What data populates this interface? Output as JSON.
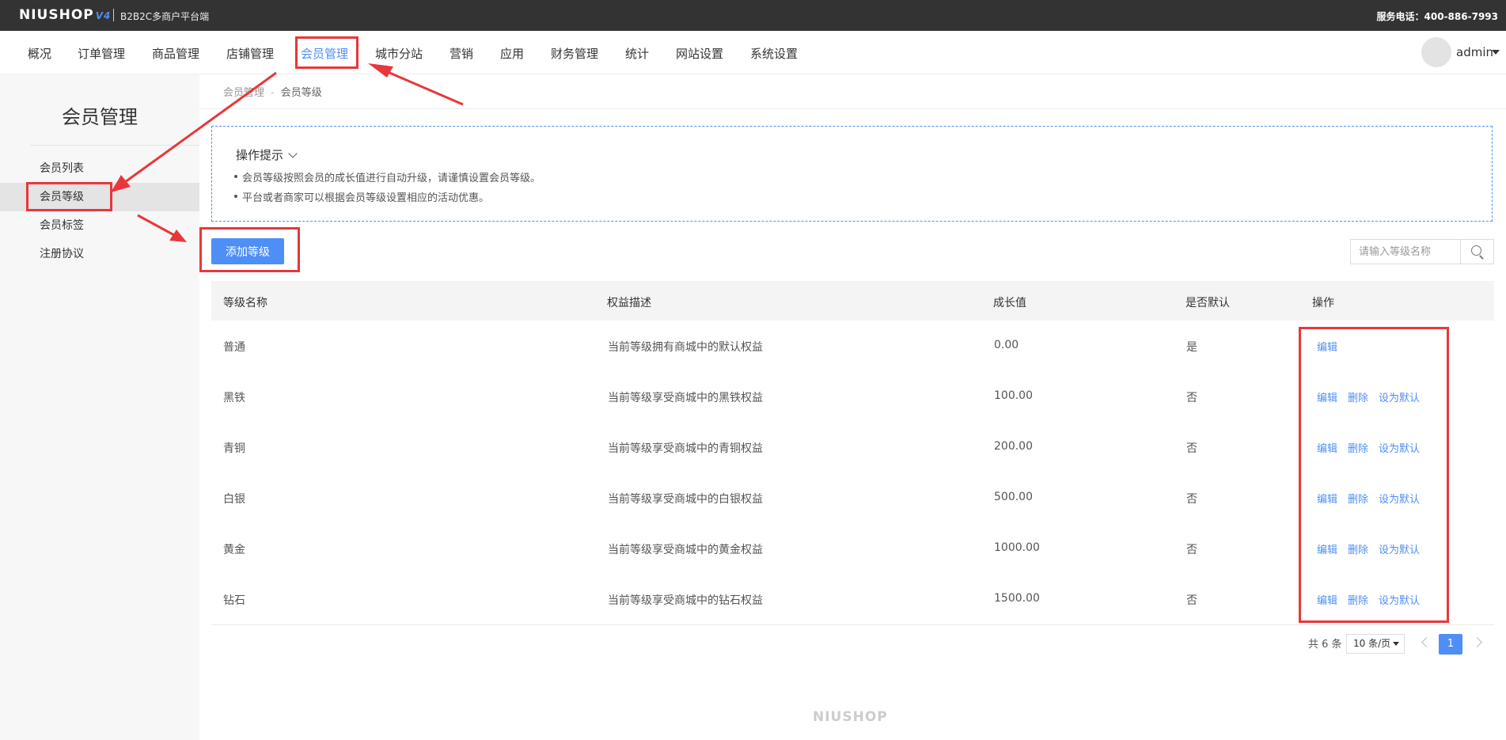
{
  "topbar": {
    "logo": "NIUSHOP",
    "logo_version": "V4",
    "subtitle": "B2B2C多商户平台端",
    "phone": "服务电话：400-886-7993"
  },
  "nav": {
    "items": [
      "概况",
      "订单管理",
      "商品管理",
      "店铺管理",
      "会员管理",
      "城市分站",
      "营销",
      "应用",
      "财务管理",
      "统计",
      "网站设置",
      "系统设置"
    ],
    "active": "会员管理",
    "user": "admin"
  },
  "sidebar": {
    "title": "会员管理",
    "items": [
      "会员列表",
      "会员等级",
      "会员标签",
      "注册协议"
    ],
    "active": "会员等级"
  },
  "breadcrumb": [
    "会员管理",
    "-",
    "会员等级"
  ],
  "tips": {
    "title": "操作提示",
    "items": [
      "会员等级按照会员的成长值进行自动升级，请谨慎设置会员等级。",
      "平台或者商家可以根据会员等级设置相应的活动优惠。"
    ]
  },
  "toolbar": {
    "add_label": "添加等级",
    "search_placeholder": "请输入等级名称"
  },
  "table": {
    "headers": [
      "等级名称",
      "权益描述",
      "成长值",
      "是否默认",
      "操作"
    ],
    "rows": [
      {
        "name": "普通",
        "desc": "当前等级拥有商城中的默认权益",
        "growth": "0.00",
        "default": "是",
        "actions": [
          "编辑"
        ]
      },
      {
        "name": "黑铁",
        "desc": "当前等级享受商城中的黑铁权益",
        "growth": "100.00",
        "default": "否",
        "actions": [
          "编辑",
          "删除",
          "设为默认"
        ]
      },
      {
        "name": "青铜",
        "desc": "当前等级享受商城中的青铜权益",
        "growth": "200.00",
        "default": "否",
        "actions": [
          "编辑",
          "删除",
          "设为默认"
        ]
      },
      {
        "name": "白银",
        "desc": "当前等级享受商城中的白银权益",
        "growth": "500.00",
        "default": "否",
        "actions": [
          "编辑",
          "删除",
          "设为默认"
        ]
      },
      {
        "name": "黄金",
        "desc": "当前等级享受商城中的黄金权益",
        "growth": "1000.00",
        "default": "否",
        "actions": [
          "编辑",
          "删除",
          "设为默认"
        ]
      },
      {
        "name": "钻石",
        "desc": "当前等级享受商城中的钻石权益",
        "growth": "1500.00",
        "default": "否",
        "actions": [
          "编辑",
          "删除",
          "设为默认"
        ]
      }
    ]
  },
  "pagination": {
    "total": "共 6 条",
    "page_size": "10 条/页",
    "current": "1"
  },
  "footer": {
    "logo": "NIUSHOP"
  },
  "colors": {
    "accent": "#4e8ef7",
    "annotation": "#e8373b",
    "topbar": "#333333"
  }
}
